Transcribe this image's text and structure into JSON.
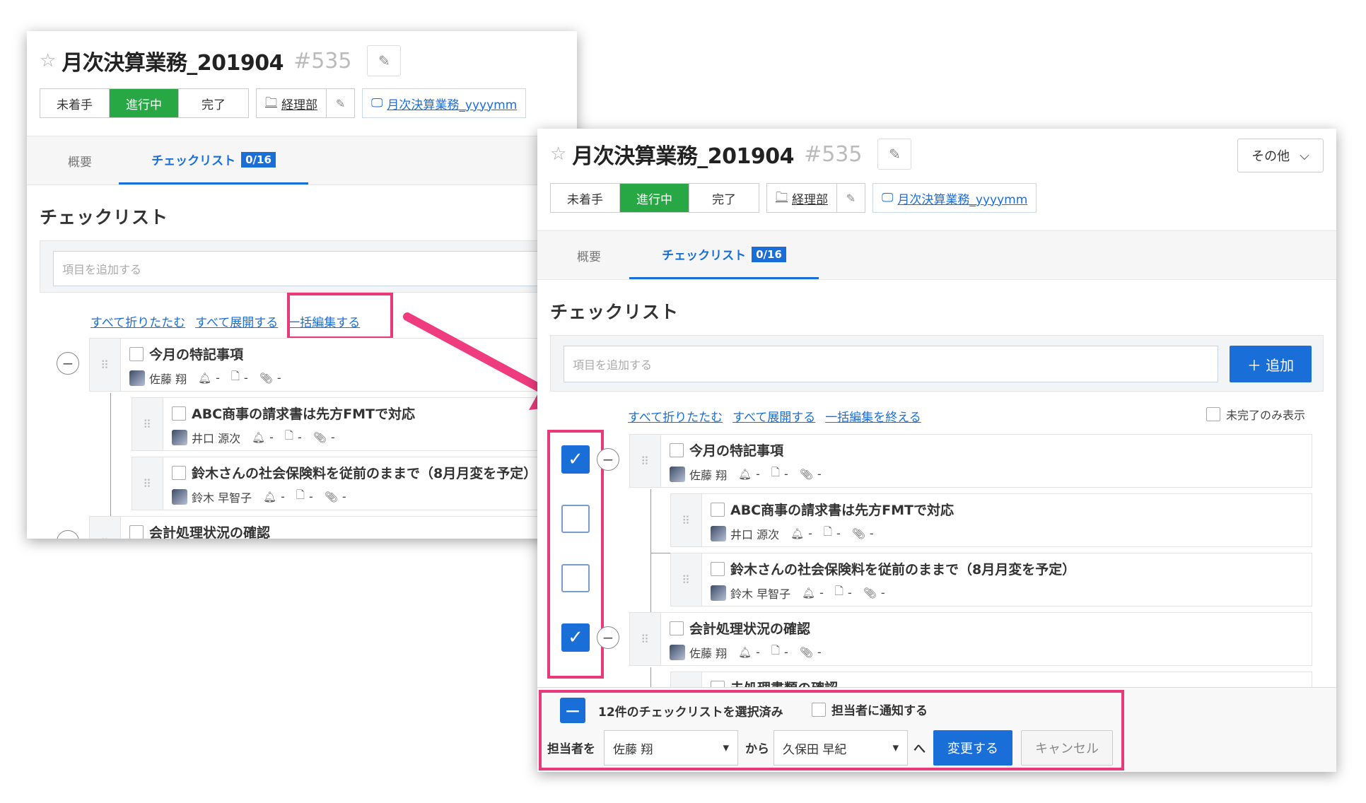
{
  "task": {
    "star": "☆",
    "title": "月次決算業務_201904",
    "number": "#535",
    "edit_icon": "✎"
  },
  "status": {
    "todo": "未着手",
    "doing": "進行中",
    "done": "完了"
  },
  "folder": {
    "icon": "🗀",
    "label": "経理部",
    "edit_icon": "✎"
  },
  "template_link": {
    "icon": "🖵",
    "label": "月次決算業務_yyyymm"
  },
  "other_menu": {
    "label": "その他",
    "chevron": "⌵"
  },
  "tabs": {
    "overview": "概要",
    "checklist": "チェックリスト",
    "checklist_badge": "0/16"
  },
  "section_title": "チェックリスト",
  "add": {
    "placeholder": "項目を追加する",
    "button": "＋ 追加"
  },
  "links_a": {
    "collapse_all": "すべて折りたたむ",
    "expand_all": "すべて展開する",
    "bulk_edit": "一括編集する"
  },
  "links_b": {
    "collapse_all": "すべて折りたたむ",
    "expand_all": "すべて展開する",
    "bulk_edit_end": "一括編集を終える",
    "incomplete_only": "未完了のみ表示"
  },
  "meta": {
    "bell": "🔔︎",
    "doc": "🗋",
    "clip": "📎︎",
    "dash": "-"
  },
  "items": [
    {
      "title": "今月の特記事項",
      "assignee": "佐藤 翔"
    },
    {
      "title": "ABC商事の請求書は先方FMTで対応",
      "assignee": "井口 源次"
    },
    {
      "title": "鈴木さんの社会保険料を従前のままで（8月月変を予定）",
      "assignee": "鈴木 早智子"
    },
    {
      "title": "会計処理状況の確認",
      "assignee": "佐藤 翔"
    },
    {
      "title": "未処理書類の確認",
      "assignee": ""
    }
  ],
  "bulk": {
    "selected_text": "12件のチェックリストを選択済み",
    "notify_label": "担当者に通知する",
    "assignee_prefix": "担当者を",
    "from_value": "佐藤 翔",
    "from_label": "から",
    "to_value": "久保田 早紀",
    "to_label": "へ",
    "apply": "変更する",
    "cancel": "キャンセル"
  },
  "colors": {
    "accent": "#1a6ed8",
    "status_active": "#28a745",
    "highlight": "#e8397a"
  }
}
